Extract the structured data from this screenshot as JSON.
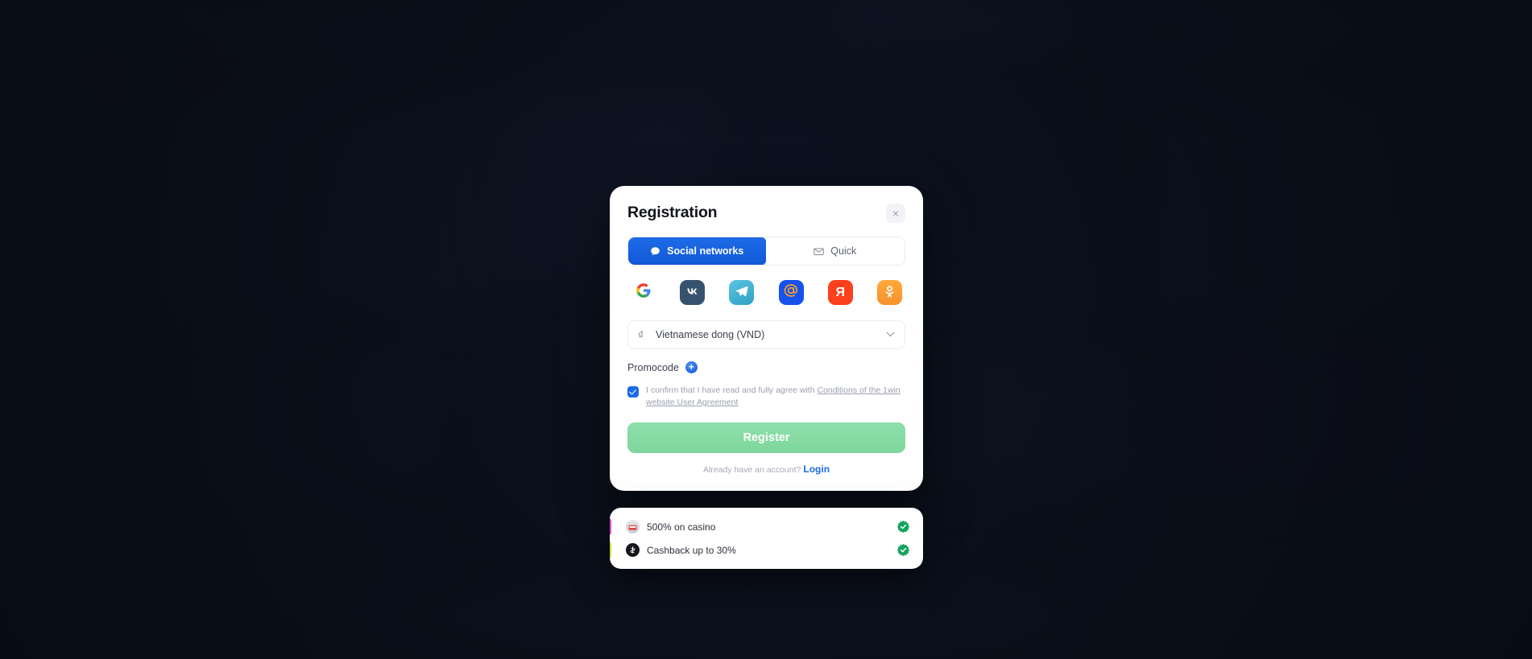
{
  "background": {
    "color": "#0c1220",
    "description": "blurred dark navy page behind modal"
  },
  "modal": {
    "title": "Registration",
    "close_label": "×",
    "tabs": [
      {
        "label": "Social networks",
        "icon": "chat-bubble-icon",
        "active": true
      },
      {
        "label": "Quick",
        "icon": "envelope-icon",
        "active": false
      }
    ],
    "social_buttons": [
      {
        "name": "google",
        "glyph": "G",
        "color": "#ffffff"
      },
      {
        "name": "vk",
        "glyph": "VK",
        "color": "#37526e"
      },
      {
        "name": "telegram",
        "glyph": "➤",
        "color": "#3aa8cc"
      },
      {
        "name": "mailru",
        "glyph": "@",
        "color": "#1652f0"
      },
      {
        "name": "yandex",
        "glyph": "Я",
        "color": "#fc3f1d"
      },
      {
        "name": "odnoklassniki",
        "glyph": "OK",
        "color": "#f8912a"
      }
    ],
    "currency": {
      "symbol": "₫",
      "value": "Vietnamese dong (VND)",
      "chevron": "⌄"
    },
    "promocode": {
      "label": "Promocode",
      "add_glyph": "+"
    },
    "agreement": {
      "checked": true,
      "text_before": "I confirm that I have read and fully agree with ",
      "link_text": "Conditions of the 1win website User Agreement"
    },
    "register_label": "Register",
    "login_prompt": "Already have an account?",
    "login_link": "Login"
  },
  "bonuses": {
    "rows": [
      {
        "text": "500% on casino",
        "icon": "casino-icon",
        "icon_glyph": "♠",
        "accent": "#e24ccf",
        "status": "checked"
      },
      {
        "text": "Cashback up to 30%",
        "icon": "coin-icon",
        "icon_glyph": "$",
        "accent": "#c8e033",
        "status": "checked"
      }
    ],
    "badge_color": "#16a45e"
  }
}
